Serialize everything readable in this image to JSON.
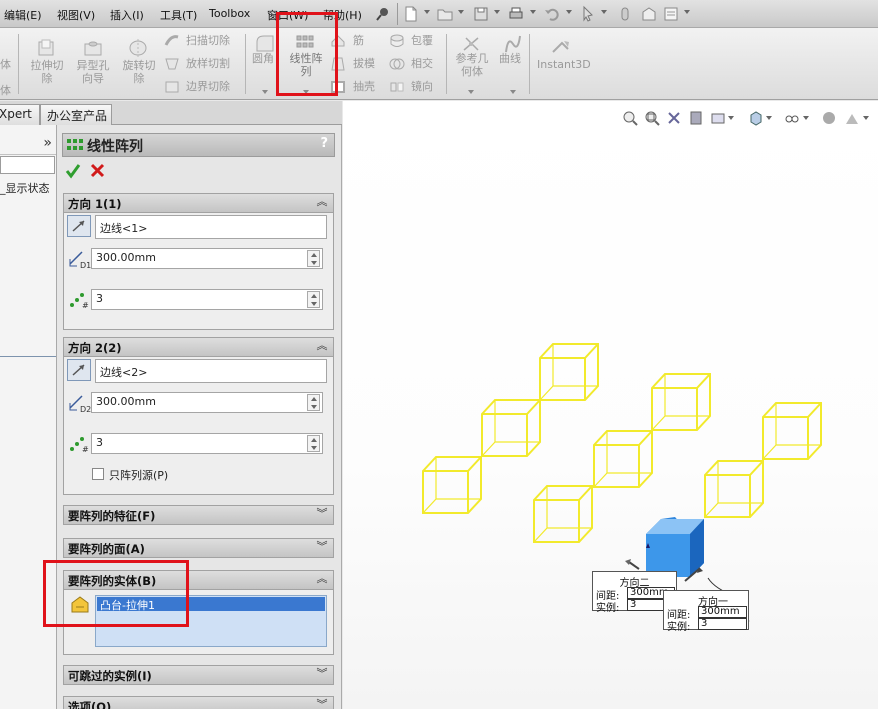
{
  "menu": {
    "items": [
      "编辑(E)",
      "视图(V)",
      "插入(I)",
      "工具(T)",
      "Toolbox",
      "窗口(W)",
      "帮助(H)"
    ]
  },
  "ribbon": {
    "partial_left_label": "体",
    "partial_left_label2": "体",
    "extrude_cut": [
      "拉伸切",
      "除"
    ],
    "hole_wizard": [
      "异型孔",
      "向导"
    ],
    "revolve_cut": [
      "旋转切",
      "除"
    ],
    "sweep_cut": "扫描切除",
    "loft_cut": "放样切割",
    "boundary_cut": "边界切除",
    "fillet": "圆角",
    "linear_pattern": [
      "线性阵",
      "列"
    ],
    "rib": "筋",
    "draft": "拔模",
    "shell": "抽壳",
    "wrap": "包覆",
    "intersect": "相交",
    "mirror": "镜向",
    "ref_geometry": [
      "参考几",
      "何体"
    ],
    "curves": "曲线",
    "instant3d": "Instant3D"
  },
  "tabs": [
    "Xpert",
    "办公室产品"
  ],
  "tree": {
    "expand_glyph": "»",
    "item": "_显示状态"
  },
  "pm": {
    "title": "线性阵列",
    "help": "?",
    "dir1": {
      "title": "方向 1(1)",
      "edge": "边线<1>",
      "spacing": "300.00mm",
      "instances": "3",
      "spacing_icon_label": "D1"
    },
    "dir2": {
      "title": "方向 2(2)",
      "edge": "边线<2>",
      "spacing": "300.00mm",
      "instances": "3",
      "spacing_icon_label": "D2",
      "seed_only_label": "只阵列源(P)"
    },
    "features": {
      "title": "要阵列的特征(F)"
    },
    "faces": {
      "title": "要阵列的面(A)"
    },
    "bodies": {
      "title": "要阵列的实体(B)",
      "selected": "凸台-拉伸1"
    },
    "skip": {
      "title": "可跳过的实例(I)"
    },
    "options": {
      "title": "选项(O)"
    }
  },
  "callouts": {
    "dir2": {
      "title": "方向二",
      "spacing_label": "间距:",
      "spacing_value": "300mm",
      "instances_label": "实例:",
      "instances_value": "3"
    },
    "dir1": {
      "title": "方向一",
      "spacing_label": "间距:",
      "spacing_value": "300mm",
      "instances_label": "实例:",
      "instances_value": "3"
    }
  },
  "colors": {
    "highlight_red": "#e0121a",
    "preview_yellow": "#f2ea2c",
    "seed_blue": "#3b8fe6",
    "selection_blue": "#3a78d0"
  }
}
